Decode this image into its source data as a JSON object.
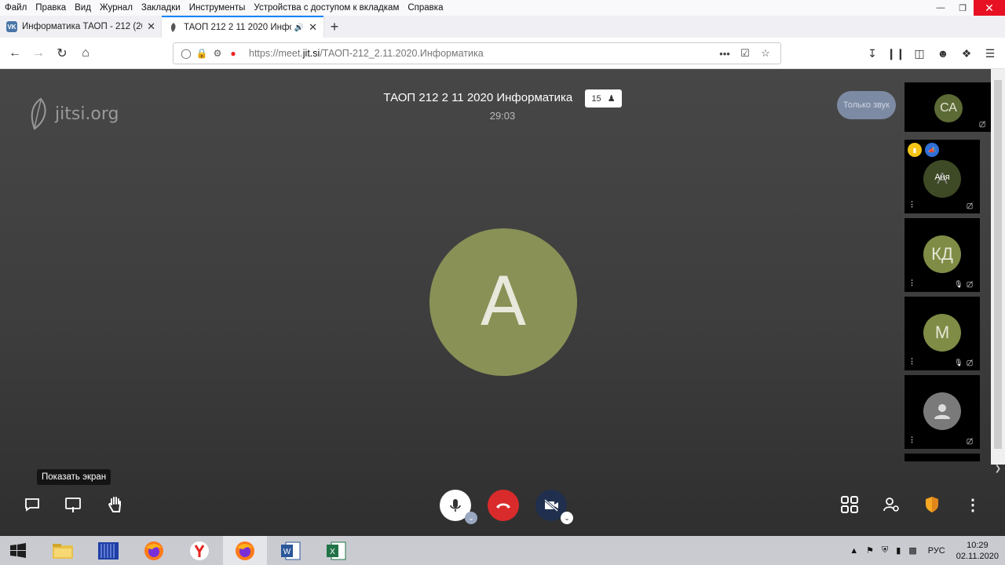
{
  "menubar": {
    "items": [
      "Файл",
      "Правка",
      "Вид",
      "Журнал",
      "Закладки",
      "Инструменты",
      "Устройства с доступом к вкладкам",
      "Справка"
    ]
  },
  "tabs": [
    {
      "title": "Информатика ТАОП - 212 (20",
      "favicon": "vk-icon",
      "favicon_text": "VK",
      "favicon_color": "#4a76a8"
    },
    {
      "title": "ТАОП 212 2 11 2020 Инфор",
      "favicon": "jitsi-leaf-icon"
    }
  ],
  "url": {
    "prefix": "https://meet.",
    "domain": "jit.si",
    "path": "/ТАОП-212_2.11.2020.Информатика"
  },
  "meeting": {
    "logo_text": "jitsi.org",
    "subject": "ТАОП 212 2 11 2020 Информатика",
    "participant_count": "15",
    "timer": "29:03",
    "audio_only_label": "Только звук",
    "main_avatar_initial": "A",
    "main_avatar_color": "#8a9156",
    "tooltip": "Показать экран"
  },
  "filmstrip": [
    {
      "initials": "СА",
      "color": "#5c6a35"
    },
    {
      "initials": "А",
      "name": "Аня",
      "color": "#3d4a25"
    },
    {
      "initials": "КД",
      "color": "#7e8c45"
    },
    {
      "initials": "М",
      "color": "#7e8c45"
    },
    {
      "initials": "",
      "color": "#7a7a7a"
    }
  ],
  "taskbar": {
    "language": "РУС",
    "time": "10:29",
    "date": "02.11.2020"
  },
  "colors": {
    "hangup": "#d92b2b",
    "accent_tab": "#0a84ff",
    "shield": "#f5a623"
  }
}
